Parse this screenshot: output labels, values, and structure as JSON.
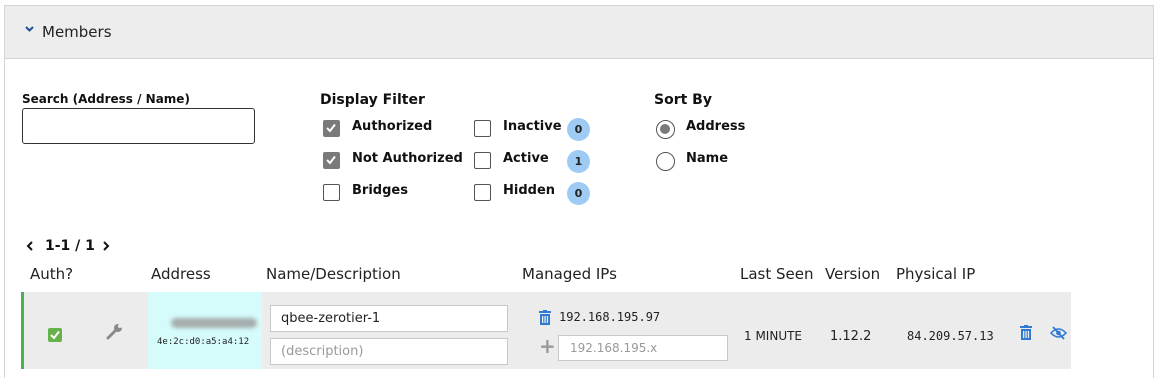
{
  "header": {
    "title": "Members",
    "icon": "chevron-down-icon"
  },
  "search": {
    "label": "Search (Address / Name)",
    "value": ""
  },
  "filter": {
    "title": "Display Filter",
    "authorized": {
      "label": "Authorized",
      "checked": true
    },
    "not_authorized": {
      "label": "Not Authorized",
      "checked": true
    },
    "bridges": {
      "label": "Bridges",
      "checked": false
    },
    "inactive": {
      "label": "Inactive",
      "checked": false,
      "count": "0"
    },
    "active": {
      "label": "Active",
      "checked": false,
      "count": "1"
    },
    "hidden": {
      "label": "Hidden",
      "checked": false,
      "count": "0"
    }
  },
  "sort": {
    "title": "Sort By",
    "address": {
      "label": "Address",
      "selected": true
    },
    "name": {
      "label": "Name",
      "selected": false
    }
  },
  "pager": {
    "text": "1-1 / 1"
  },
  "columns": {
    "auth": "Auth?",
    "address": "Address",
    "name": "Name/Description",
    "ips": "Managed IPs",
    "last_seen": "Last Seen",
    "version": "Version",
    "physical_ip": "Physical IP"
  },
  "member": {
    "authorized": true,
    "address": "4e:2c:d0:a5:a4:12",
    "name": "qbee-zerotier-1",
    "description_placeholder": "(description)",
    "managed_ip": "192.168.195.97",
    "new_ip_placeholder": "192.168.195.x",
    "last_seen": "1 MINUTE",
    "version": "1.12.2",
    "physical_ip": "84.209.57.13"
  },
  "colors": {
    "accent": "#4caf50",
    "badge": "#9ecbf3",
    "icon_blue": "#2f79d1",
    "address_bg": "#d6fbfb"
  }
}
